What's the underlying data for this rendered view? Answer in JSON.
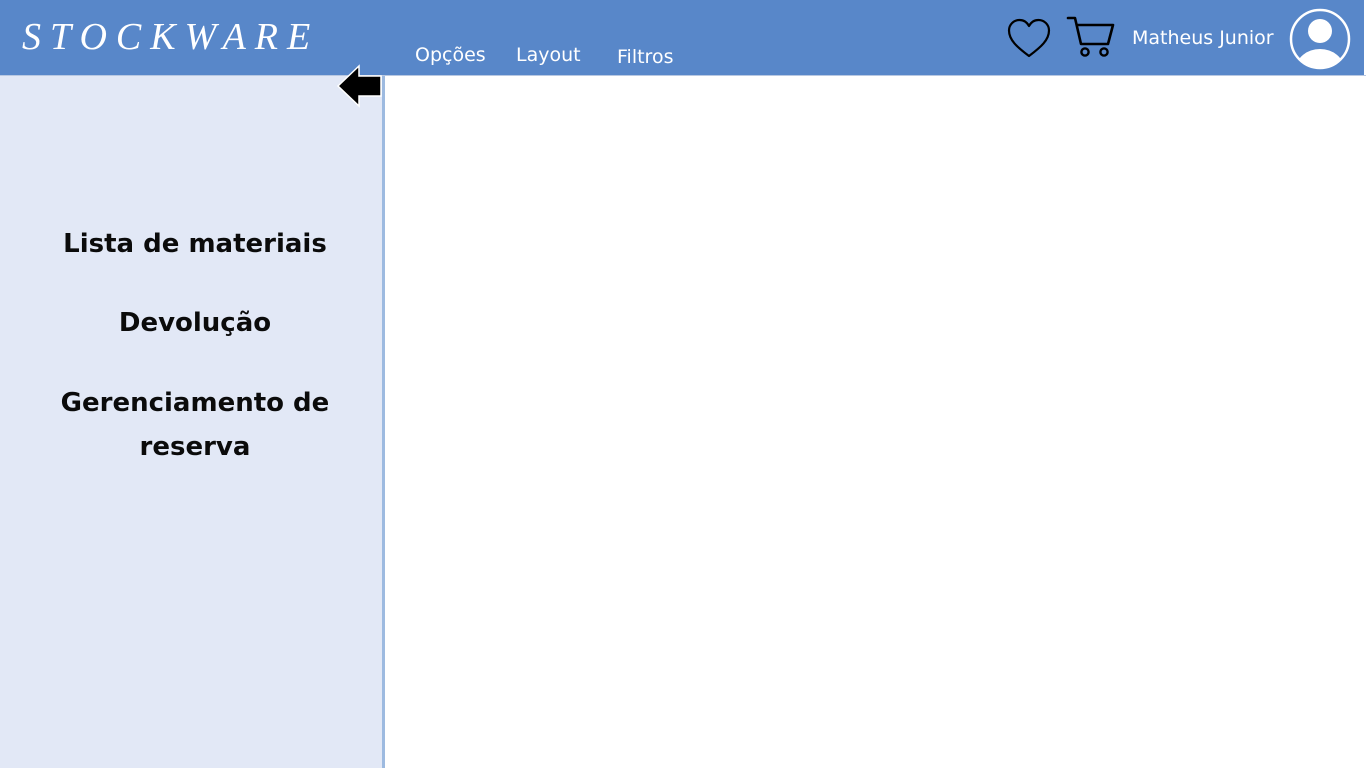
{
  "header": {
    "logo": "STOCKWARE",
    "nav": [
      "Opções",
      "Layout",
      "Filtros"
    ],
    "user_name": "Matheus Junior",
    "icons": [
      "heart-icon",
      "cart-icon",
      "user-avatar-icon"
    ]
  },
  "sidebar": {
    "collapse_icon": "arrow-left-icon",
    "items": [
      {
        "label": "Lista de materiais"
      },
      {
        "label": "Devolução"
      },
      {
        "label": "Gerenciamento de reserva"
      }
    ]
  },
  "colors": {
    "header_bg": "#5887c9",
    "sidebar_bg": "#e2e8f6",
    "text_dark": "#0b0b0b",
    "text_light": "#ffffff"
  }
}
